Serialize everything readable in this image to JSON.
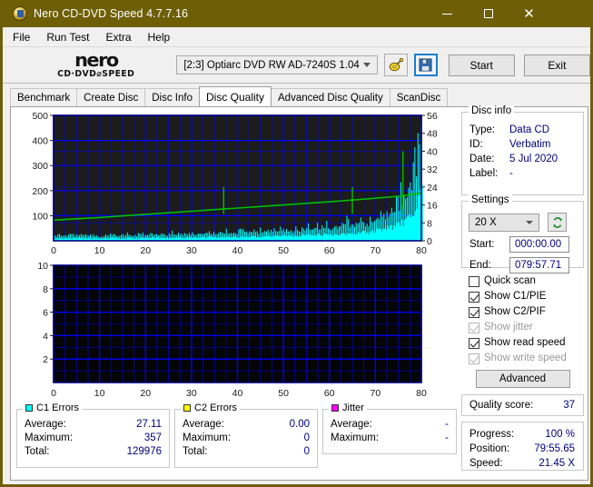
{
  "window": {
    "title": "Nero CD-DVD Speed 4.7.7.16",
    "app_icon": "nero-disc-icon",
    "minimize": "–",
    "maximize": "□",
    "close": "✕",
    "titlebar_color": "#6e5f07"
  },
  "menu": {
    "items": [
      {
        "label": "File"
      },
      {
        "label": "Run Test"
      },
      {
        "label": "Extra"
      },
      {
        "label": "Help"
      }
    ]
  },
  "toolbar": {
    "logo_main": "nero",
    "logo_sub": "CD·DVD⌀SPEED",
    "drive": "[2:3]   Optiarc DVD RW AD-7240S 1.04",
    "eject_icon": "disc-tool-icon",
    "save_icon": "floppy-save-icon",
    "start_label": "Start",
    "exit_label": "Exit"
  },
  "tabs": [
    {
      "label": "Benchmark",
      "active": false
    },
    {
      "label": "Create Disc",
      "active": false
    },
    {
      "label": "Disc Info",
      "active": false
    },
    {
      "label": "Disc Quality",
      "active": true
    },
    {
      "label": "Advanced Disc Quality",
      "active": false
    },
    {
      "label": "ScanDisc",
      "active": false
    }
  ],
  "disc_info": {
    "legend": "Disc info",
    "rows": [
      {
        "key": "Type:",
        "value": "Data CD"
      },
      {
        "key": "ID:",
        "value": "Verbatim"
      },
      {
        "key": "Date:",
        "value": "5 Jul 2020"
      },
      {
        "key": "Label:",
        "value": "-"
      }
    ]
  },
  "settings": {
    "legend": "Settings",
    "speed": "20 X",
    "refresh_icon": "refresh-arrows-icon",
    "start_label": "Start:",
    "start_value": "000:00.00",
    "end_label": "End:",
    "end_value": "079:57.71"
  },
  "options": [
    {
      "label": "Quick scan",
      "checked": false,
      "enabled": true
    },
    {
      "label": "Show C1/PIE",
      "checked": true,
      "enabled": true
    },
    {
      "label": "Show C2/PIF",
      "checked": true,
      "enabled": true
    },
    {
      "label": "Show jitter",
      "checked": true,
      "enabled": false
    },
    {
      "label": "Show read speed",
      "checked": true,
      "enabled": true
    },
    {
      "label": "Show write speed",
      "checked": true,
      "enabled": false
    }
  ],
  "advanced_label": "Advanced",
  "quality": {
    "label": "Quality score:",
    "value": "37"
  },
  "progress": {
    "rows": [
      {
        "key": "Progress:",
        "value": "100 %"
      },
      {
        "key": "Position:",
        "value": "79:55.65"
      },
      {
        "key": "Speed:",
        "value": "21.45 X"
      }
    ]
  },
  "stats": {
    "c1": {
      "legend": "C1 Errors",
      "color": "#00ffff",
      "rows": [
        {
          "key": "Average:",
          "value": "27.11"
        },
        {
          "key": "Maximum:",
          "value": "357"
        },
        {
          "key": "Total:",
          "value": "129976"
        }
      ]
    },
    "c2": {
      "legend": "C2 Errors",
      "color": "#ffff00",
      "rows": [
        {
          "key": "Average:",
          "value": "0.00"
        },
        {
          "key": "Maximum:",
          "value": "0"
        },
        {
          "key": "Total:",
          "value": "0"
        }
      ]
    },
    "jitter": {
      "legend": "Jitter",
      "color": "#ff00ff",
      "rows": [
        {
          "key": "Average:",
          "value": "-"
        },
        {
          "key": "Maximum:",
          "value": "-"
        }
      ]
    }
  },
  "chart_data": [
    {
      "id": "c1-chart",
      "type": "area",
      "title": "C1 Errors / Read speed",
      "xlabel": "",
      "ylabel": "",
      "xlim": [
        0,
        80
      ],
      "xticks": [
        0,
        10,
        20,
        30,
        40,
        50,
        60,
        70,
        80
      ],
      "ylim": [
        0,
        500
      ],
      "yticks": [
        100,
        200,
        300,
        400,
        500
      ],
      "y2lim": [
        0,
        56
      ],
      "y2ticks": [
        0,
        8,
        16,
        24,
        32,
        40,
        48,
        56
      ],
      "grid": true,
      "background": "#1c1c1c",
      "gridcolor": "#0000ff",
      "legend": "none",
      "series": [
        {
          "name": "C1 Errors",
          "type": "area",
          "color": "#00ffff",
          "axis": "left",
          "x": [
            0,
            2,
            4,
            6,
            8,
            10,
            12,
            14,
            16,
            18,
            20,
            22,
            24,
            26,
            28,
            30,
            32,
            34,
            36,
            38,
            40,
            42,
            44,
            46,
            48,
            50,
            52,
            54,
            56,
            58,
            60,
            62,
            64,
            66,
            68,
            70,
            72,
            74,
            75,
            76,
            77,
            78,
            79,
            80
          ],
          "values": [
            14,
            18,
            16,
            20,
            17,
            15,
            19,
            17,
            21,
            18,
            20,
            22,
            19,
            23,
            21,
            24,
            22,
            26,
            24,
            28,
            26,
            30,
            28,
            33,
            31,
            36,
            34,
            40,
            38,
            45,
            43,
            52,
            50,
            60,
            58,
            72,
            85,
            100,
            120,
            140,
            165,
            200,
            260,
            357
          ]
        },
        {
          "name": "Read speed",
          "type": "line",
          "color": "#00c000",
          "axis": "right",
          "x": [
            0,
            5,
            10,
            15,
            20,
            25,
            30,
            35,
            40,
            45,
            50,
            55,
            60,
            65,
            70,
            75,
            79,
            80
          ],
          "values": [
            9.2,
            9.8,
            10.4,
            11.1,
            11.8,
            12.5,
            13.2,
            13.9,
            14.6,
            15.3,
            16.0,
            16.7,
            17.4,
            18.2,
            19.0,
            19.9,
            21.0,
            21.45
          ]
        }
      ],
      "annotations": [
        {
          "type": "speed-spike",
          "x": 37,
          "note": "green dip spike"
        },
        {
          "type": "speed-spike",
          "x": 65,
          "note": "green spike to 24"
        },
        {
          "type": "speed-spike",
          "x": 76,
          "note": "green spike to 40"
        }
      ]
    },
    {
      "id": "c2-chart",
      "type": "area",
      "title": "C2 Errors",
      "xlabel": "",
      "ylabel": "",
      "xlim": [
        0,
        80
      ],
      "xticks": [
        0,
        10,
        20,
        30,
        40,
        50,
        60,
        70,
        80
      ],
      "ylim": [
        0,
        10
      ],
      "yticks": [
        2,
        4,
        6,
        8,
        10
      ],
      "grid": true,
      "background": "#050505",
      "gridcolor": "#0000ff",
      "legend": "none",
      "series": [
        {
          "name": "C2 Errors",
          "type": "area",
          "color": "#ffff00",
          "x": [
            0,
            80
          ],
          "values": [
            0,
            0
          ]
        }
      ]
    }
  ]
}
